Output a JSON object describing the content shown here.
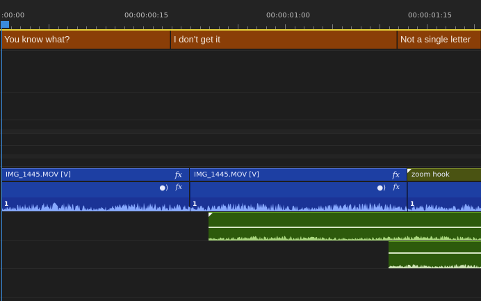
{
  "ruler": {
    "timecodes": [
      ":00:00",
      "00:00:00:15",
      "00:00:01:00",
      "00:00:01:15"
    ]
  },
  "captions": [
    "You know what?",
    "I don't get it",
    "Not a single letter"
  ],
  "video_clips": [
    {
      "name": "IMG_1445.MOV [V]",
      "fx": "fx"
    },
    {
      "name": "IMG_1445.MOV [V]",
      "fx": "fx"
    },
    {
      "name": "zoom hook"
    }
  ],
  "audio_clips": [
    {
      "channel": "1",
      "fx": "fx"
    },
    {
      "channel": "1",
      "fx": "fx"
    },
    {
      "channel": "1"
    }
  ],
  "colors": {
    "caption": "#8a3e07",
    "video": "#1d3fa3",
    "adjustment": "#4a5312",
    "green_audio": "#2d5a0c",
    "playhead": "#3a8bdc"
  }
}
